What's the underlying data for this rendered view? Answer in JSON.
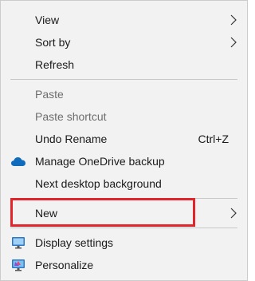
{
  "menu": {
    "items": [
      {
        "label": "View",
        "submenu": true
      },
      {
        "label": "Sort by",
        "submenu": true
      },
      {
        "label": "Refresh"
      },
      {
        "label": "Paste",
        "disabled": true
      },
      {
        "label": "Paste shortcut",
        "disabled": true
      },
      {
        "label": "Undo Rename",
        "shortcut": "Ctrl+Z"
      },
      {
        "label": "Manage OneDrive backup",
        "icon": "onedrive-icon"
      },
      {
        "label": "Next desktop background"
      },
      {
        "label": "New",
        "submenu": true
      },
      {
        "label": "Display settings",
        "icon": "display-settings-icon"
      },
      {
        "label": "Personalize",
        "icon": "personalize-icon"
      }
    ]
  },
  "colors": {
    "menu_background": "#f2f2f2",
    "disabled_text": "#6d6d6d",
    "highlight_border": "#e3242b",
    "onedrive_blue": "#0f6cbd"
  }
}
